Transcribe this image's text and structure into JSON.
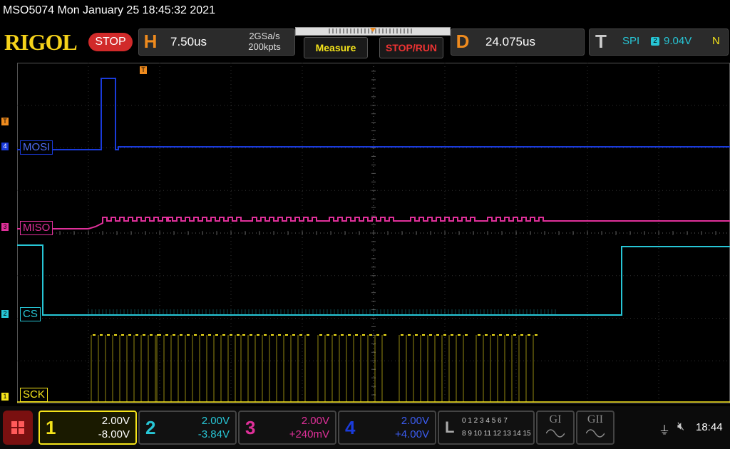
{
  "header": {
    "title": "MSO5074  Mon January 25 18:45:32 2021",
    "logo": "RIGOL",
    "status": "STOP"
  },
  "horizontal": {
    "letter": "H",
    "timebase": "7.50us",
    "sample_rate": "2GSa/s",
    "memory_depth": "200kpts"
  },
  "buttons": {
    "measure": "Measure",
    "stop_run": "STOP/RUN"
  },
  "delay": {
    "letter": "D",
    "value": "24.075us"
  },
  "trigger": {
    "letter": "T",
    "type": "SPI",
    "source": "2",
    "level": "9.04V",
    "mode": "N"
  },
  "signals": {
    "mosi": {
      "label": "MOSI",
      "channel": "4",
      "color": "#1a3bdb"
    },
    "miso": {
      "label": "MISO",
      "channel": "3",
      "color": "#e0309a"
    },
    "cs": {
      "label": "CS",
      "channel": "2",
      "color": "#27c6d6"
    },
    "sck": {
      "label": "SCK",
      "channel": "1",
      "color": "#f5e41a"
    },
    "trigger_marker": "T"
  },
  "channels": [
    {
      "num": "1",
      "scale": "2.00V",
      "offset": "-8.00V",
      "color": "#f5e41a"
    },
    {
      "num": "2",
      "scale": "2.00V",
      "offset": "-3.84V",
      "color": "#27c6d6"
    },
    {
      "num": "3",
      "scale": "2.00V",
      "offset": "+240mV",
      "color": "#e0309a"
    },
    {
      "num": "4",
      "scale": "2.00V",
      "offset": "+4.00V",
      "color": "#1a3bdb"
    }
  ],
  "logic": {
    "letter": "L",
    "row1": "0 1 2 3  4 5 6 7",
    "row2": "8 9 10 11 12 13 14 15"
  },
  "generators": {
    "g1": "GI",
    "g2": "GII"
  },
  "status_bar": {
    "time": "18:44"
  }
}
